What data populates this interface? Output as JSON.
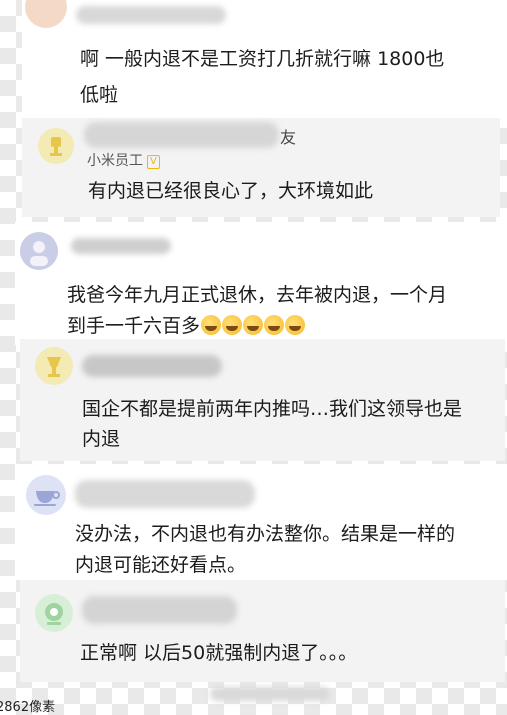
{
  "comments": [
    {
      "text_line1": "啊 一般内退不是工资打几折就行嘛 1800也",
      "text_line2": "低啦",
      "reply": {
        "username_suffix": "友",
        "badge": "小米员工",
        "badge_tag": "V",
        "text": "有内退已经很良心了，大环境如此"
      }
    },
    {
      "text_line1": "我爸今年九月正式退休，去年被内退，一个月",
      "text_line2": "到手一千六百多",
      "emoji_count": 5,
      "reply": {
        "text_line1": "国企不都是提前两年内推吗…我们这领导也是",
        "text_line2": "内退"
      }
    },
    {
      "text_line1": "没办法，不内退也有办法整你。结果是一样的",
      "text_line2": "内退可能还好看点。",
      "reply": {
        "text": "正常啊 以后50就强制内退了。。。"
      }
    }
  ],
  "footer": {
    "text": "2862像素"
  },
  "colors": {
    "accent": "#f2b705",
    "text": "#1c1c1c"
  },
  "icons": [
    "avatar-icon",
    "trophy-icon",
    "teacup-icon",
    "camera-icon"
  ]
}
